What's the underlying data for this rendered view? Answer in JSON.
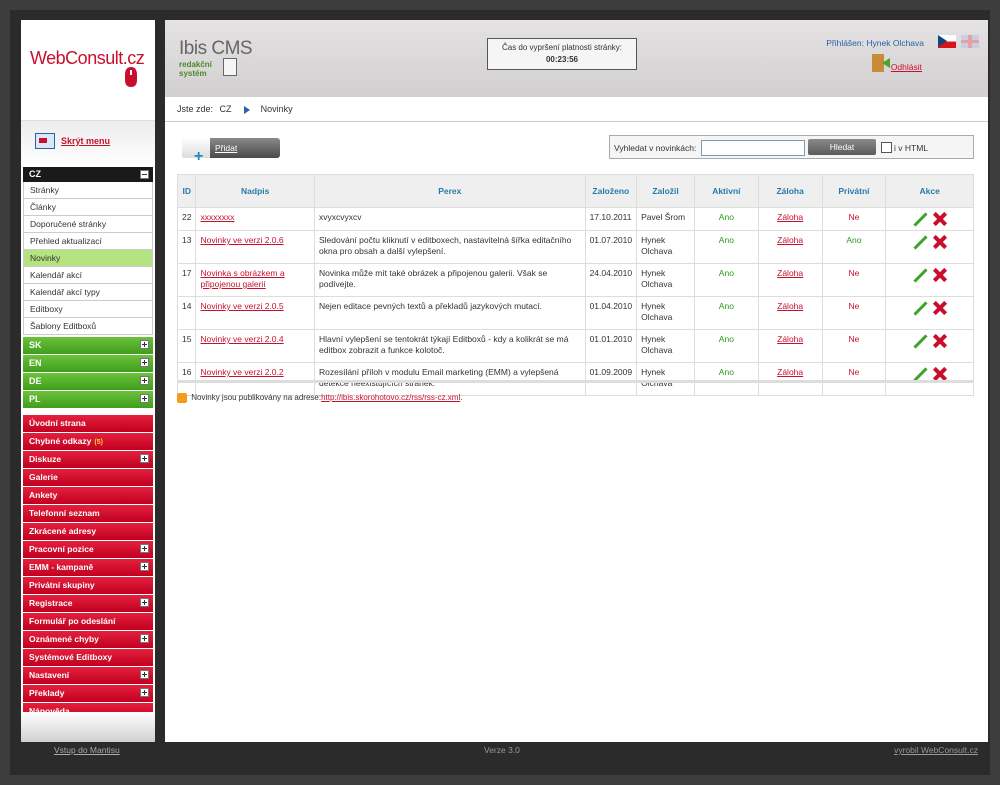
{
  "logo": {
    "text": "WebConsult.cz"
  },
  "sidebar": {
    "hide_menu": "Skrýt menu",
    "cz": {
      "label": "CZ",
      "items": [
        "Stránky",
        "Články",
        "Doporučené stránky",
        "Přehled aktualizací",
        "Novinky",
        "Kalendář akcí",
        "Kalendář akcí typy",
        "Editboxy",
        "Šablony Editboxů"
      ],
      "active_index": 4
    },
    "languages": [
      "SK",
      "EN",
      "DE",
      "PL"
    ],
    "red_items": [
      {
        "label": "Úvodní strana",
        "plus": false
      },
      {
        "label": "Chybné odkazy",
        "badge": "(5)",
        "plus": false
      },
      {
        "label": "Diskuze",
        "plus": true
      },
      {
        "label": "Galerie",
        "plus": false
      },
      {
        "label": "Ankety",
        "plus": false
      },
      {
        "label": "Telefonní seznam",
        "plus": false
      },
      {
        "label": "Zkrácené adresy",
        "plus": false
      },
      {
        "label": "Pracovní pozice",
        "plus": true
      },
      {
        "label": "EMM - kampaně",
        "plus": true
      },
      {
        "label": "Privátní skupiny",
        "plus": false
      },
      {
        "label": "Registrace",
        "plus": true
      },
      {
        "label": "Formulář po odeslání",
        "plus": false
      },
      {
        "label": "Oznámené chyby",
        "plus": true
      },
      {
        "label": "Systémové Editboxy",
        "plus": false
      },
      {
        "label": "Nastavení",
        "plus": true
      },
      {
        "label": "Překlady",
        "plus": true
      },
      {
        "label": "Nápověda",
        "plus": false
      }
    ]
  },
  "header": {
    "brand": "Ibis CMS",
    "brand_sub1": "redakční",
    "brand_sub2": "systém",
    "timer_label": "Čas do vypršení platnosti stránky:",
    "timer_value": "00:23:56",
    "logged_in": "Přihlášen: Hynek Olchava",
    "logout": "Odhlásit"
  },
  "breadcrumb": {
    "prefix": "Jste zde:",
    "items": [
      "CZ",
      "Novinky"
    ]
  },
  "toolbar": {
    "add": "Přidat",
    "search_label": "Vyhledat v novinkách:",
    "search_value": "",
    "search_button": "Hledat",
    "html_checkbox_label": "i v HTML"
  },
  "table": {
    "columns": [
      "ID",
      "Nadpis",
      "Perex",
      "Založeno",
      "Založil",
      "Aktivní",
      "Záloha",
      "Privátní",
      "Akce"
    ],
    "rows": [
      {
        "id": "22",
        "title": "xxxxxxxx",
        "perex": "xvyxcvyxcv",
        "created": "17.10.2011",
        "author": "Pavel Šrom",
        "active": "Ano",
        "backup": "Záloha",
        "private": "Ne"
      },
      {
        "id": "13",
        "title": "Novinky ve verzi 2.0.6",
        "perex": "Sledování počtu kliknutí v editboxech, nastavitelná šířka editačního okna pro obsah a další vylepšení.",
        "created": "01.07.2010",
        "author": "Hynek Olchava",
        "active": "Ano",
        "backup": "Záloha",
        "private": "Ano"
      },
      {
        "id": "17",
        "title": "Novinka s obrázkem a připojenou galerií",
        "perex": "Novinka může mít také obrázek a připojenou galerii. Však se podívejte.",
        "created": "24.04.2010",
        "author": "Hynek Olchava",
        "active": "Ano",
        "backup": "Záloha",
        "private": "Ne"
      },
      {
        "id": "14",
        "title": "Novinky ve verzi 2.0.5",
        "perex": "Nejen editace pevných textů a překladů jazykových mutací.",
        "created": "01.04.2010",
        "author": "Hynek Olchava",
        "active": "Ano",
        "backup": "Záloha",
        "private": "Ne"
      },
      {
        "id": "15",
        "title": "Novinky ve verzi 2.0.4",
        "perex": "Hlavní vylepšení se tentokrát týkají Editboxů - kdy a kolikrát se má editbox zobrazit a funkce kolotoč.",
        "created": "01.01.2010",
        "author": "Hynek Olchava",
        "active": "Ano",
        "backup": "Záloha",
        "private": "Ne"
      },
      {
        "id": "16",
        "title": "Novinky ve verzi 2.0.2",
        "perex": "Rozesílání příloh v modulu Email marketing (EMM) a vylepšená detekce neexistujících stránek.",
        "created": "01.09.2009",
        "author": "Hynek Olchava",
        "active": "Ano",
        "backup": "Záloha",
        "private": "Ne"
      }
    ]
  },
  "rss": {
    "text": "Novinky jsou publikovány na adrese:",
    "url": "http://ibis.skorohotovo.cz/rss/rss-cz.xml",
    "suffix": "."
  },
  "footer": {
    "left": "Vstup do Mantisu",
    "middle": "Verze 3.0",
    "right": "vyrobil WebConsult.cz"
  },
  "colors": {
    "accent_red": "#c8102e",
    "accent_green": "#3e9e1c",
    "link_blue": "#2a62a6"
  }
}
